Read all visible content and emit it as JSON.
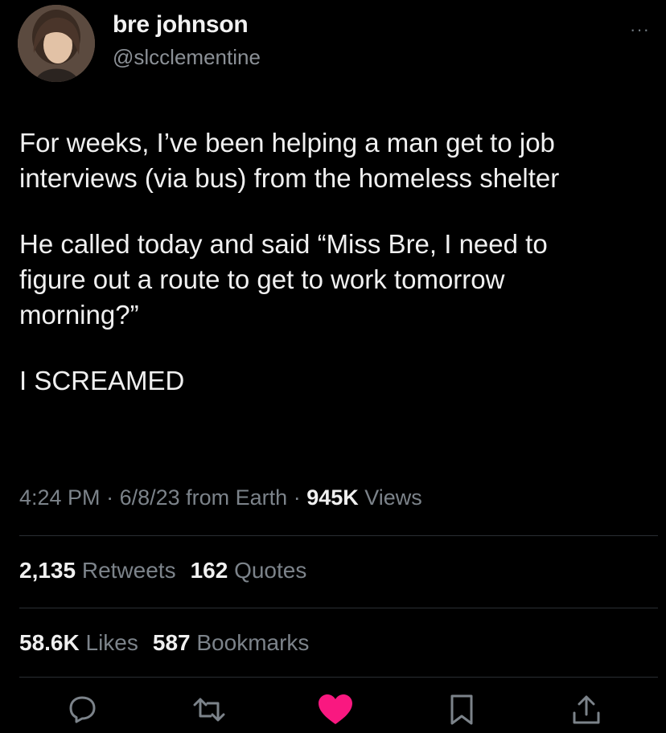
{
  "user": {
    "name": "bre johnson",
    "handle": "@slcclementine",
    "more_label": "···"
  },
  "tweet": {
    "paragraphs": [
      "For weeks, I’ve been helping a man get to job\ninterviews (via bus) from the homeless shelter",
      "He called today and said “Miss Bre, I need to\nfigure out a route to get to work tomorrow\nmorning?”",
      "I SCREAMED"
    ]
  },
  "meta": {
    "time": "4:24 PM",
    "sep1": " · ",
    "date": "6/8/23",
    "source": " from Earth",
    "sep2": " · ",
    "views_count": "945K",
    "views_label": " Views"
  },
  "stats": {
    "retweets_count": "2,135",
    "retweets_label": " Retweets",
    "quotes_count": "162",
    "quotes_label": " Quotes",
    "likes_count": "58.6K",
    "likes_label": " Likes",
    "bookmarks_count": "587",
    "bookmarks_label": " Bookmarks"
  },
  "actions": [
    {
      "icon": "reply-icon"
    },
    {
      "icon": "retweet-icon"
    },
    {
      "icon": "heart-icon",
      "color": "#f91880",
      "active": true
    },
    {
      "icon": "bookmark-icon"
    },
    {
      "icon": "share-icon"
    }
  ],
  "colors": {
    "background": "#000000",
    "text": "#f0f0f0",
    "muted": "#7c838a",
    "like": "#f91880"
  }
}
